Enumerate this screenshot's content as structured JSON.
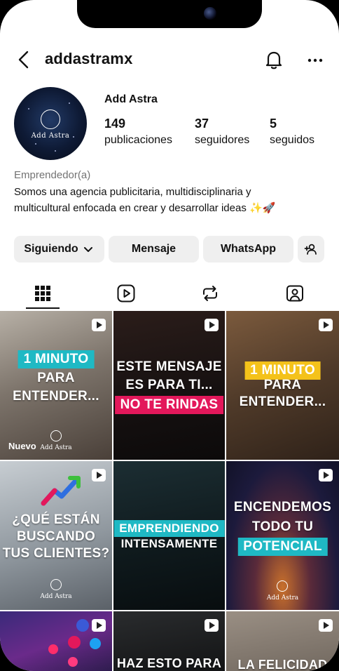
{
  "header": {
    "username": "addastramx"
  },
  "profile": {
    "display_name": "Add Astra",
    "avatar_text": "Add Astra",
    "stats": [
      {
        "value": "149",
        "label": "publicaciones"
      },
      {
        "value": "37",
        "label": "seguidores"
      },
      {
        "value": "5",
        "label": "seguidos"
      }
    ],
    "category": "Emprendedor(a)",
    "bio_line1": "Somos una agencia publicitaria, multidisciplinaria y",
    "bio_line2": "multicultural enfocada en crear y desarrollar ideas ✨🚀"
  },
  "actions": {
    "following_label": "Siguiendo",
    "message_label": "Mensaje",
    "whatsapp_label": "WhatsApp"
  },
  "tabs": [
    "posts-grid-icon",
    "reels-icon",
    "reposts-icon",
    "tagged-icon"
  ],
  "posts": [
    {
      "band": "1 MINUTO",
      "lines": [
        "PARA",
        "ENTENDER..."
      ],
      "badge": "Nuevo",
      "brand": "Add Astra"
    },
    {
      "lines": [
        "ESTE MENSAJE",
        "ES PARA TI..."
      ],
      "band": "NO TE RINDAS"
    },
    {
      "band": "1 MINUTO",
      "lines": [
        "PARA",
        "ENTENDER..."
      ]
    },
    {
      "lines": [
        "¿QUÉ ESTÁN",
        "BUSCANDO",
        "TUS CLIENTES?"
      ],
      "brand": "Add Astra"
    },
    {
      "band": "EMPRENDIENDO",
      "lines": [
        "INTENSAMENTE"
      ]
    },
    {
      "lines": [
        "ENCENDEMOS",
        "TODO TU"
      ],
      "band": "POTENCIAL",
      "brand": "Add Astra"
    },
    {
      "lines": []
    },
    {
      "lines": [
        "HAZ ESTO PARA"
      ]
    },
    {
      "lines": [
        "LA FELICIDAD"
      ]
    }
  ],
  "colors": {
    "button_bg": "#efefef",
    "cyan_band": "#1fb9c4",
    "yellow_band": "#f4c21a",
    "pink_band": "#e3185b"
  }
}
